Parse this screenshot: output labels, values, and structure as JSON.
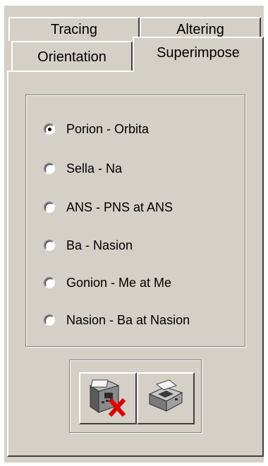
{
  "tabs": {
    "tracing": "Tracing",
    "altering": "Altering",
    "orientation": "Orientation",
    "superimpose": "Superimpose"
  },
  "superimpose": {
    "options": [
      {
        "label": "Porion - Orbita",
        "checked": true
      },
      {
        "label": "Sella - Na",
        "checked": false
      },
      {
        "label": "ANS - PNS at ANS",
        "checked": false
      },
      {
        "label": "Ba - Nasion",
        "checked": false
      },
      {
        "label": "Gonion - Me at Me",
        "checked": false
      },
      {
        "label": "Nasion - Ba at Nasion",
        "checked": false
      }
    ]
  },
  "buttons": {
    "left_icon": "fax-machine-with-red-x-icon",
    "right_icon": "printer-icon"
  },
  "colors": {
    "face": "#d4d0c8",
    "highlight": "#ffffff",
    "shadow": "#808080",
    "dark_shadow": "#404040",
    "error_red": "#e00000"
  }
}
